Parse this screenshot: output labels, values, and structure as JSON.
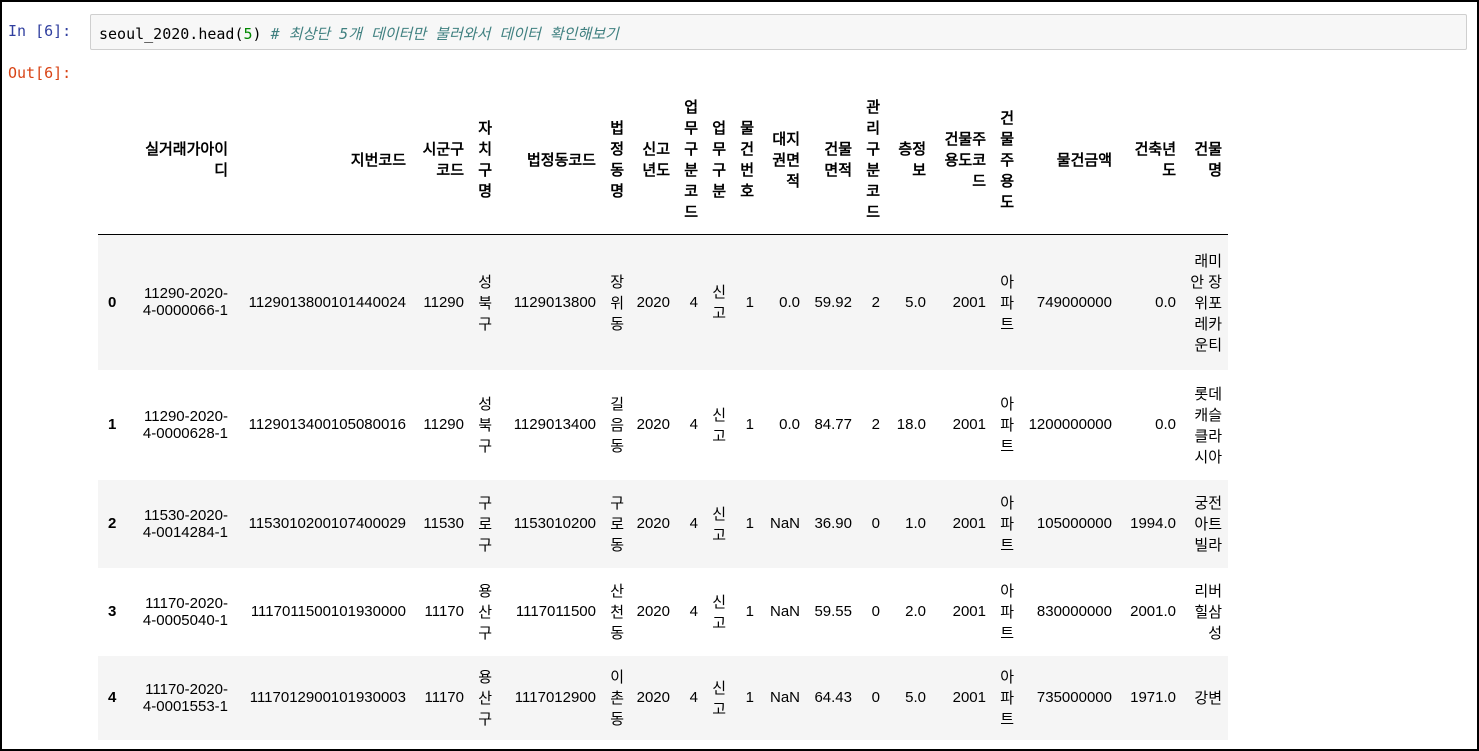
{
  "cell": {
    "in_prompt": "In [6]:",
    "out_prompt": "Out[6]:",
    "code_prefix": "seoul_2020.head(",
    "code_arg": "5",
    "code_suffix": ") ",
    "code_comment": "# 최상단 5개 데이터만 불러와서 데이터 확인해보기"
  },
  "table": {
    "index_header": "",
    "columns": [
      "실거래가아이디",
      "지번코드",
      "시군구코드",
      "자치구명",
      "법정동코드",
      "법정동명",
      "신고년도",
      "업무구분코드",
      "업무구분",
      "물건번호",
      "대지권면적",
      "건물면적",
      "관리구분코드",
      "층정보",
      "건물주용도코드",
      "건물주용도",
      "물건금액",
      "건축년도",
      "건물명"
    ],
    "rows": [
      {
        "index": "0",
        "cells": [
          "11290-2020-4-0000066-1",
          "1129013800101440024",
          "11290",
          "성북구",
          "1129013800",
          "장위동",
          "2020",
          "4",
          "신고",
          "1",
          "0.0",
          "59.92",
          "2",
          "5.0",
          "2001",
          "아파트",
          "749000000",
          "0.0",
          "래미안 장위포레카운티"
        ]
      },
      {
        "index": "1",
        "cells": [
          "11290-2020-4-0000628-1",
          "1129013400105080016",
          "11290",
          "성북구",
          "1129013400",
          "길음동",
          "2020",
          "4",
          "신고",
          "1",
          "0.0",
          "84.77",
          "2",
          "18.0",
          "2001",
          "아파트",
          "1200000000",
          "0.0",
          "롯데캐슬클라시아"
        ]
      },
      {
        "index": "2",
        "cells": [
          "11530-2020-4-0014284-1",
          "1153010200107400029",
          "11530",
          "구로구",
          "1153010200",
          "구로동",
          "2020",
          "4",
          "신고",
          "1",
          "NaN",
          "36.90",
          "0",
          "1.0",
          "2001",
          "아파트",
          "105000000",
          "1994.0",
          "궁전아트빌라"
        ]
      },
      {
        "index": "3",
        "cells": [
          "11170-2020-4-0005040-1",
          "1117011500101930000",
          "11170",
          "용산구",
          "1117011500",
          "산천동",
          "2020",
          "4",
          "신고",
          "1",
          "NaN",
          "59.55",
          "0",
          "2.0",
          "2001",
          "아파트",
          "830000000",
          "2001.0",
          "리버힐삼성"
        ]
      },
      {
        "index": "4",
        "cells": [
          "11170-2020-4-0001553-1",
          "1117012900101930003",
          "11170",
          "용산구",
          "1117012900",
          "이촌동",
          "2020",
          "4",
          "신고",
          "1",
          "NaN",
          "64.43",
          "0",
          "5.0",
          "2001",
          "아파트",
          "735000000",
          "1971.0",
          "강변"
        ]
      }
    ]
  }
}
